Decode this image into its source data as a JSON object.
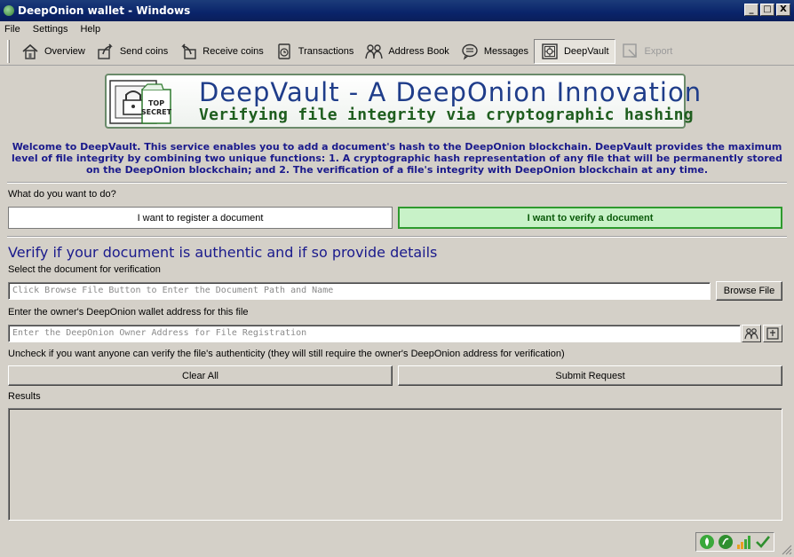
{
  "window": {
    "title": "DeepOnion wallet - Windows",
    "controls": [
      "_",
      "□",
      "X"
    ]
  },
  "menu": [
    "File",
    "Settings",
    "Help"
  ],
  "toolbar": [
    {
      "label": "Overview",
      "icon": "home-icon"
    },
    {
      "label": "Send coins",
      "icon": "send-icon"
    },
    {
      "label": "Receive coins",
      "icon": "receive-icon"
    },
    {
      "label": "Transactions",
      "icon": "transactions-icon"
    },
    {
      "label": "Address Book",
      "icon": "address-book-icon"
    },
    {
      "label": "Messages",
      "icon": "messages-icon"
    },
    {
      "label": "DeepVault",
      "icon": "deepvault-icon",
      "active": true
    },
    {
      "label": "Export",
      "icon": "export-icon",
      "disabled": true
    }
  ],
  "banner": {
    "logo_text": "TOP SECRET",
    "title": "DeepVault - A DeepOnion Innovation",
    "subtitle": "Verifying file integrity via cryptographic hashing"
  },
  "intro": "Welcome to DeepVault. This service enables you to add a document's hash to the DeepOnion blockchain. DeepVault provides the maximum level of file integrity by combining two unique functions: 1. A cryptographic hash representation of any file that will be permanently stored on the DeepOnion blockchain; and 2. The verification of a file's integrity with DeepOnion blockchain at any time.",
  "prompt": "What do you want to do?",
  "mode": {
    "register_label": "I want to register a document",
    "verify_label": "I want to verify a document"
  },
  "verify": {
    "title": "Verify if your document is authentic and if so provide details",
    "file_label": "Select the document for verification",
    "file_placeholder": "Click Browse File Button to Enter the Document Path and Name",
    "browse_label": "Browse File",
    "owner_label": "Enter the owner's DeepOnion wallet address for this file",
    "owner_placeholder": "Enter the DeepOnion Owner Address for File Registration",
    "uncheck_note": "Uncheck if you want anyone can verify the file's authenticity (they will still require the owner's DeepOnion address for verification)",
    "clear_label": "Clear All",
    "submit_label": "Submit Request",
    "results_label": "Results"
  },
  "colors": {
    "accent_blue": "#1a1a8c",
    "verify_green": "#c8f2c8"
  }
}
